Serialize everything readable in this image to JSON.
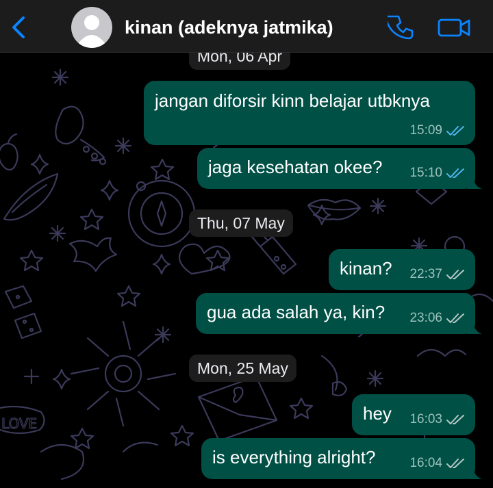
{
  "header": {
    "contact_name": "kinan (adeknya jatmika)",
    "back_icon": "chevron-left-icon",
    "call_icon": "phone-icon",
    "video_icon": "video-camera-icon",
    "accent_color": "#0a84ff",
    "background_color": "#1c1c1d"
  },
  "chat": {
    "bubble_color": "#005046",
    "read_tick_color": "#4fb6ec",
    "delivered_tick_color": "#b6c9c6",
    "dates": [
      {
        "label": "Mon, 06 Apr"
      },
      {
        "label": "Thu, 07 May"
      },
      {
        "label": "Mon, 25 May"
      }
    ],
    "messages": [
      {
        "text": "jangan diforsir kinn belajar utbknya",
        "time": "15:09",
        "status": "read"
      },
      {
        "text": "jaga kesehatan okee?",
        "time": "15:10",
        "status": "read"
      },
      {
        "text": "kinan?",
        "time": "22:37",
        "status": "delivered"
      },
      {
        "text": "gua ada salah ya, kin?",
        "time": "23:06",
        "status": "delivered"
      },
      {
        "text": "hey",
        "time": "16:03",
        "status": "delivered"
      },
      {
        "text": "is everything alright?",
        "time": "16:04",
        "status": "delivered"
      }
    ]
  }
}
